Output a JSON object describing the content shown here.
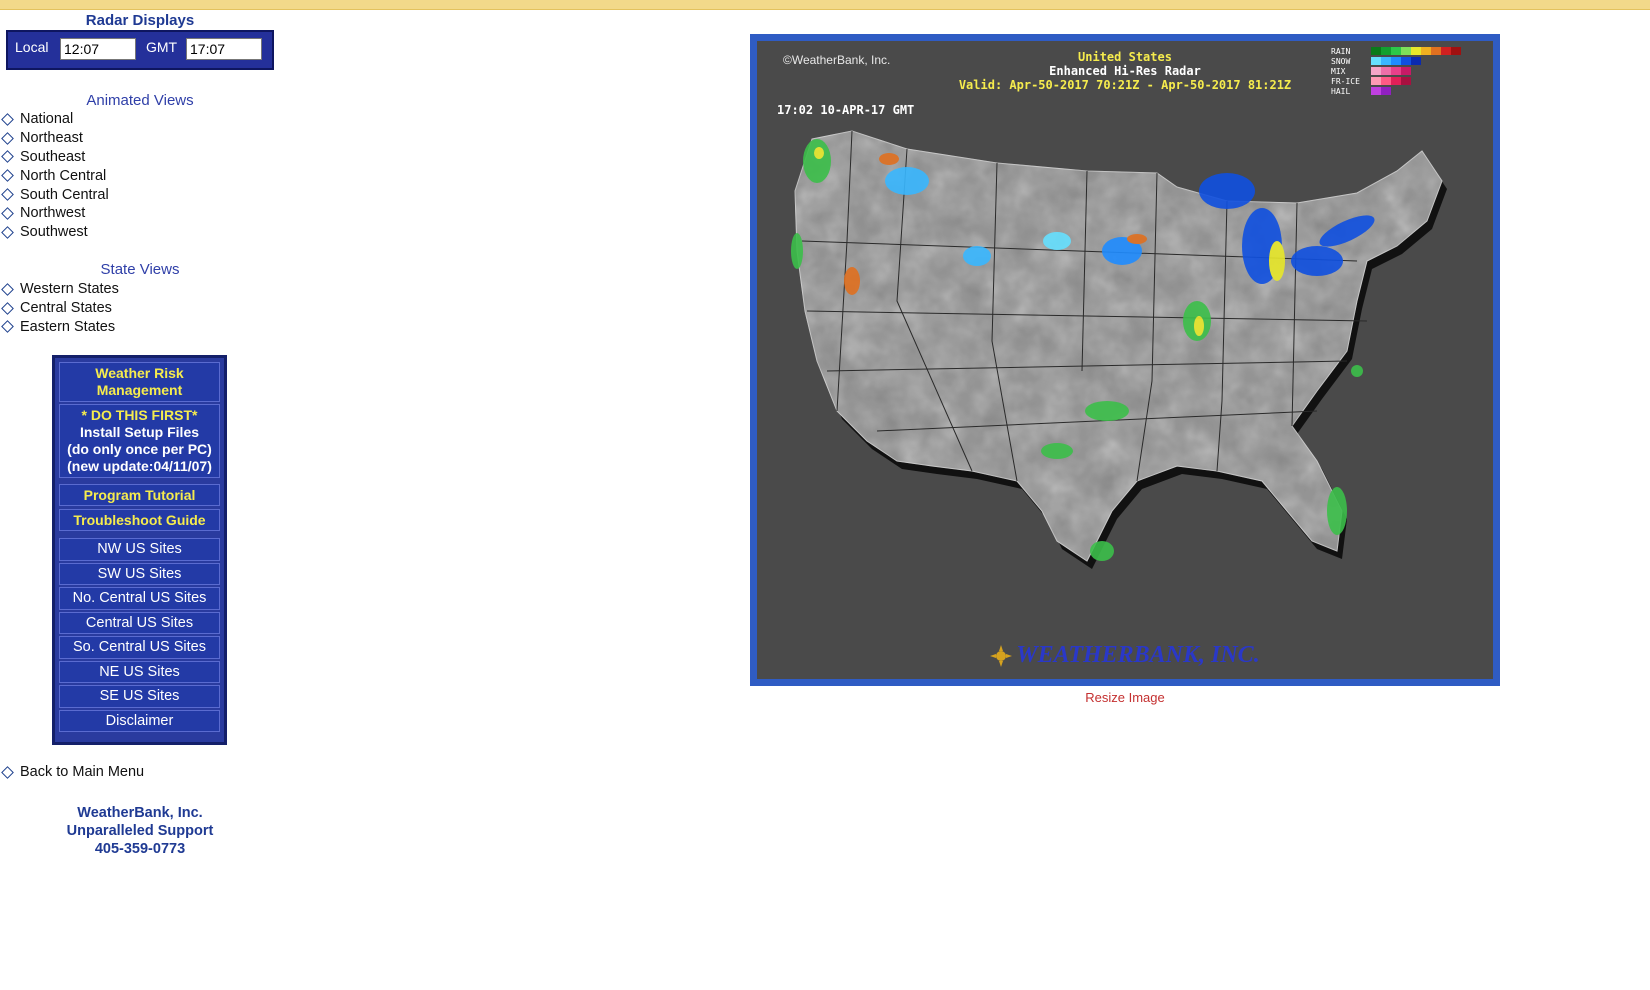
{
  "sidebar": {
    "title": "Radar Displays",
    "local_label": "Local",
    "local_time": "12:07",
    "gmt_label": "GMT",
    "gmt_time": "17:07",
    "animated_title": "Animated Views",
    "animated": [
      "National",
      "Northeast",
      "Southeast",
      "North Central",
      "South Central",
      "Northwest",
      "Southwest"
    ],
    "state_title": "State Views",
    "states": [
      "Western States",
      "Central States",
      "Eastern States"
    ],
    "wrm": {
      "title_line1": "Weather Risk",
      "title_line2": "Management",
      "first_line1": "* DO THIS FIRST*",
      "first_line2": "Install Setup Files",
      "first_line3": "(do only once per PC)",
      "first_line4": "(new update:04/11/07)",
      "tutorial": "Program Tutorial",
      "troubleshoot": "Troubleshoot Guide",
      "sites": [
        "NW US Sites",
        "SW US Sites",
        "No. Central US Sites",
        "Central US Sites",
        "So. Central US Sites",
        "NE US Sites",
        "SE US Sites",
        "Disclaimer"
      ]
    },
    "back": "Back to Main Menu",
    "company_line1": "WeatherBank, Inc.",
    "company_line2": "Unparalleled Support",
    "company_line3": "405-359-0773"
  },
  "radar": {
    "copyright": "©WeatherBank, Inc.",
    "title": "United States",
    "subtitle": "Enhanced Hi-Res Radar",
    "valid": "Valid: Apr-50-2017 70:21Z - Apr-50-2017 81:21Z",
    "timestamp": "17:02 10-APR-17 GMT",
    "legend": [
      "RAIN",
      "SNOW",
      "MIX",
      "FR-ICE",
      "HAIL"
    ],
    "brand": "WEATHERBANK, INC.",
    "colors": {
      "rain": [
        "#0a7a1a",
        "#12a030",
        "#2cc84a",
        "#7ee05a",
        "#e8e82a",
        "#f0b020",
        "#e07020",
        "#d02020",
        "#a01010"
      ],
      "snow": [
        "#66e0ff",
        "#39b7ff",
        "#1f8cff",
        "#1050e0",
        "#0a2ab0"
      ],
      "mix": [
        "#f4a6c8",
        "#ef6fa8",
        "#e8408a",
        "#c81a66"
      ],
      "ice": [
        "#ff9ab5",
        "#ff5a86",
        "#e02058",
        "#a81040"
      ],
      "hail": [
        "#c040e0",
        "#9020c0"
      ]
    }
  },
  "resize": "Resize Image"
}
